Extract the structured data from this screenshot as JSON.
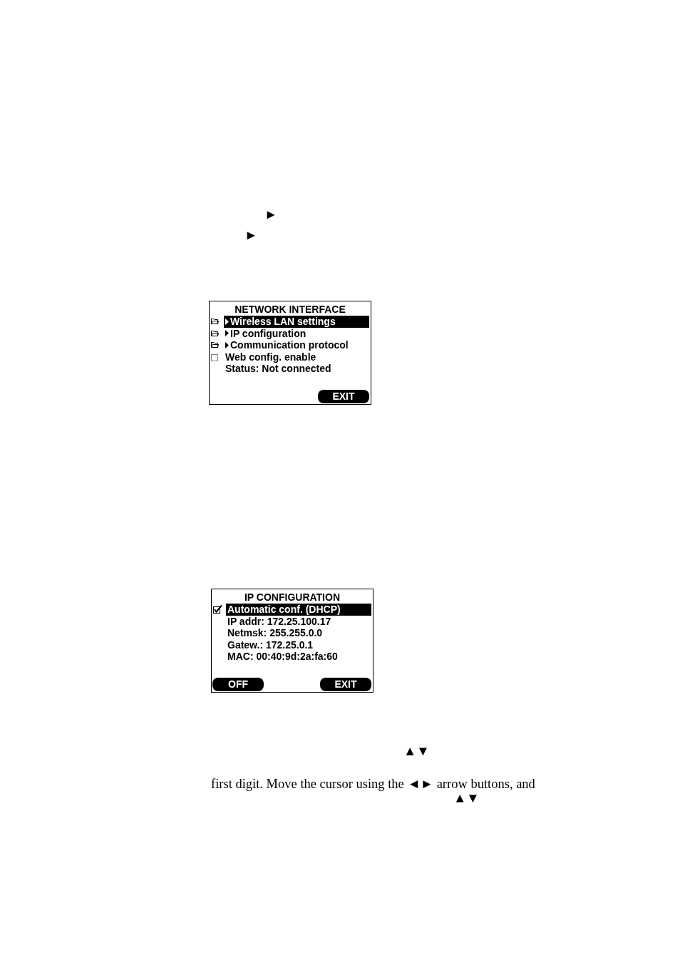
{
  "top_markers": [
    "►",
    "►"
  ],
  "screens": [
    {
      "title": "NETWORK INTERFACE",
      "rows": [
        {
          "kind": "folder",
          "label": "Wireless LAN settings",
          "selected": true
        },
        {
          "kind": "folder",
          "label": "IP configuration",
          "selected": false
        },
        {
          "kind": "folder",
          "label": "Communication protocol",
          "selected": false
        },
        {
          "kind": "checkbox",
          "label": "Web config. enable",
          "checked": false,
          "selected": false
        },
        {
          "kind": "text",
          "label": "Status: Not connected",
          "selected": false
        }
      ],
      "softkeys": {
        "right": "EXIT"
      }
    },
    {
      "title": "IP CONFIGURATION",
      "rows": [
        {
          "kind": "checkbox",
          "label": "Automatic conf. (DHCP)",
          "checked": true,
          "selected": true
        },
        {
          "kind": "text",
          "label": "IP addr: 172.25.100.17",
          "selected": false
        },
        {
          "kind": "text",
          "label": "Netmsk: 255.255.0.0",
          "selected": false
        },
        {
          "kind": "text",
          "label": "Gatew.: 172.25.0.1",
          "selected": false
        },
        {
          "kind": "text",
          "label": "MAC: 00:40:9d:2a:fa:60",
          "selected": false
        }
      ],
      "softkeys": {
        "left": "OFF",
        "right": "EXIT"
      }
    }
  ],
  "key_hint": "▲▼",
  "sentence": "first digit. Move the cursor using the ◄► arrow buttons, and",
  "key_hint_2": "▲▼"
}
